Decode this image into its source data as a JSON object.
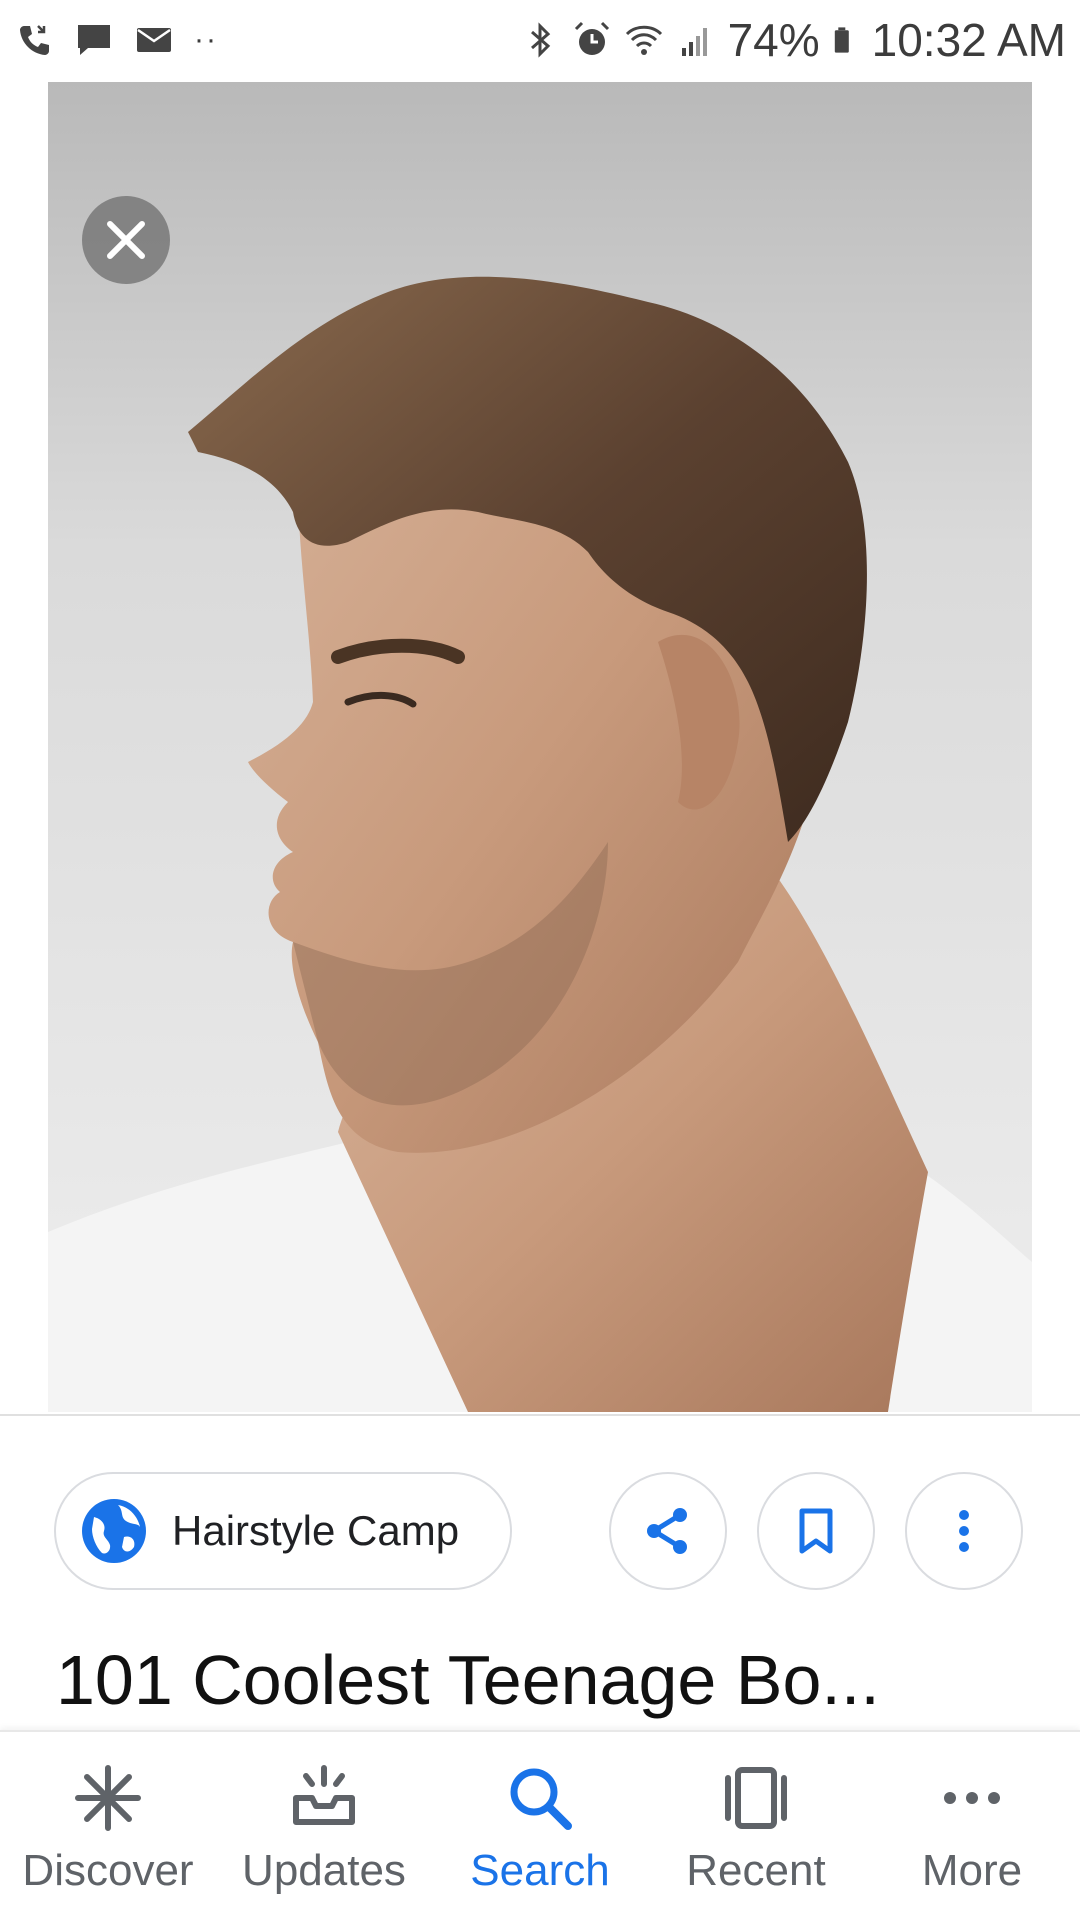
{
  "status_bar": {
    "battery": "74%",
    "time": "10:32 AM",
    "dots": "··",
    "icons": [
      "missed-call-icon",
      "message-icon",
      "email-icon",
      "bluetooth-icon",
      "alarm-icon",
      "wifi-icon",
      "signal-icon",
      "battery-icon"
    ]
  },
  "viewer": {
    "close_icon": "close-icon",
    "image_subject": "man-profile-haircut-photo"
  },
  "actions": {
    "source_name": "Hairstyle Camp",
    "source_icon": "globe-icon",
    "share_icon": "share-icon",
    "save_icon": "bookmark-icon",
    "more_icon": "more-vertical-icon"
  },
  "result": {
    "title": "101 Coolest Teenage Bo..."
  },
  "bottom_nav": {
    "items": [
      {
        "label": "Discover",
        "icon": "asterisk-icon",
        "active": false
      },
      {
        "label": "Updates",
        "icon": "inbox-tray-icon",
        "active": false
      },
      {
        "label": "Search",
        "icon": "search-icon",
        "active": true
      },
      {
        "label": "Recent",
        "icon": "recent-cards-icon",
        "active": false
      },
      {
        "label": "More",
        "icon": "more-horizontal-icon",
        "active": false
      }
    ]
  },
  "colors": {
    "accent": "#1a73e8",
    "nav_inactive": "#5f6368",
    "chip_border": "#dadce0"
  }
}
